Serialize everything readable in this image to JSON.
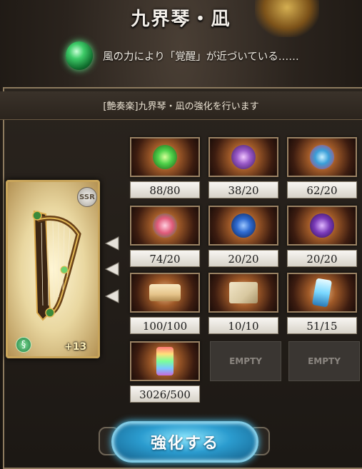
{
  "title": "九界琴・凪",
  "message": "風の力により「覚醒」が近づいている……",
  "panel_header": "[艶奏楽]九界琴・凪の強化を行います",
  "card": {
    "rarity": "SSR",
    "plus": "+13",
    "element_icon": "wind-icon"
  },
  "materials": [
    {
      "icon": "green-eye-orb-icon",
      "count": "88/80",
      "color": "#4fd14a"
    },
    {
      "icon": "purple-flower-icon",
      "count": "38/20",
      "color": "#9a5ac8"
    },
    {
      "icon": "blue-feather-icon",
      "count": "62/20",
      "color": "#3a9ed8"
    },
    {
      "icon": "pink-rose-icon",
      "count": "74/20",
      "color": "#e05a7a"
    },
    {
      "icon": "blue-orb-icon",
      "count": "20/20",
      "color": "#2f6bd1"
    },
    {
      "icon": "purple-gem-icon",
      "count": "20/20",
      "color": "#7a3ab8"
    },
    {
      "icon": "scroll-icon",
      "count": "100/100",
      "color": "#e6c48a"
    },
    {
      "icon": "parchment-icon",
      "count": "10/10",
      "color": "#d8c8a0"
    },
    {
      "icon": "blue-crystal-icon",
      "count": "51/15",
      "color": "#7ad8ff"
    },
    {
      "icon": "rainbow-crystal-icon",
      "count": "3026/500",
      "color": "#c86ad8"
    }
  ],
  "empty_slots": [
    "EMPTY",
    "EMPTY"
  ],
  "enhance_button": "強化する"
}
